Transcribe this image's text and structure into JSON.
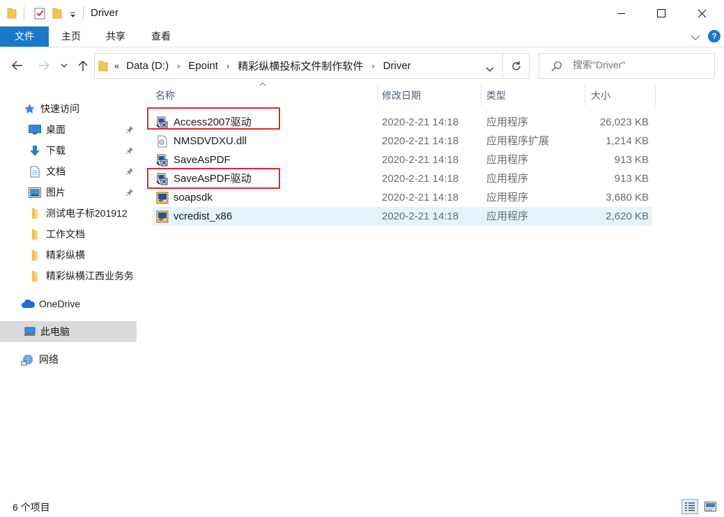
{
  "window": {
    "title": "Driver",
    "controls": {
      "minimize": "─",
      "maximize": "☐",
      "close": "✕"
    }
  },
  "ribbon": {
    "tabs": [
      "文件",
      "主页",
      "共享",
      "查看"
    ],
    "help": "?"
  },
  "address": {
    "overflow": "«",
    "crumbs": [
      "Data (D:)",
      "Epoint",
      "精彩纵横投标文件制作软件",
      "Driver"
    ],
    "separator": "›"
  },
  "search": {
    "placeholder": "搜索\"Driver\""
  },
  "nav_pane": {
    "items": [
      {
        "label": "快速访问",
        "icon": "star-icon",
        "pinned": false
      },
      {
        "label": "桌面",
        "icon": "desktop-icon",
        "pinned": true
      },
      {
        "label": "下载",
        "icon": "download-icon",
        "pinned": true
      },
      {
        "label": "文档",
        "icon": "document-icon",
        "pinned": true
      },
      {
        "label": "图片",
        "icon": "picture-icon",
        "pinned": true
      },
      {
        "label": "测试电子标201912",
        "icon": "folder-icon",
        "pinned": false
      },
      {
        "label": "工作文档",
        "icon": "folder-icon",
        "pinned": false
      },
      {
        "label": "精彩纵横",
        "icon": "folder-icon",
        "pinned": false
      },
      {
        "label": "精彩纵横江西业务务",
        "icon": "folder-icon",
        "pinned": false
      },
      {
        "label": "OneDrive",
        "icon": "cloud-icon",
        "pinned": false
      },
      {
        "label": "此电脑",
        "icon": "computer-icon",
        "pinned": false,
        "selected": true
      },
      {
        "label": "网络",
        "icon": "network-icon",
        "pinned": false
      }
    ]
  },
  "file_list": {
    "columns": [
      "名称",
      "修改日期",
      "类型",
      "大小"
    ],
    "rows": [
      {
        "name": "Access2007驱动",
        "date": "2020-2-21 14:18",
        "type": "应用程序",
        "size": "26,023 KB",
        "icon": "installer-icon",
        "highlighted": true
      },
      {
        "name": "NMSDVDXU.dll",
        "date": "2020-2-21 14:18",
        "type": "应用程序扩展",
        "size": "1,214 KB",
        "icon": "dll-icon"
      },
      {
        "name": "SaveAsPDF",
        "date": "2020-2-21 14:18",
        "type": "应用程序",
        "size": "913 KB",
        "icon": "installer-icon"
      },
      {
        "name": "SaveAsPDF驱动",
        "date": "2020-2-21 14:18",
        "type": "应用程序",
        "size": "913 KB",
        "icon": "installer-icon",
        "highlighted": true
      },
      {
        "name": "soapsdk",
        "date": "2020-2-21 14:18",
        "type": "应用程序",
        "size": "3,680 KB",
        "icon": "setup-icon"
      },
      {
        "name": "vcredist_x86",
        "date": "2020-2-21 14:18",
        "type": "应用程序",
        "size": "2,620 KB",
        "icon": "setup-icon",
        "selected": true
      }
    ]
  },
  "status_bar": {
    "item_count": "6 个项目"
  },
  "colors": {
    "accent": "#1979ca",
    "highlight_box": "#e2262f",
    "selected_row": "#e5f3ff",
    "selected_nav": "#d9d9d9"
  }
}
